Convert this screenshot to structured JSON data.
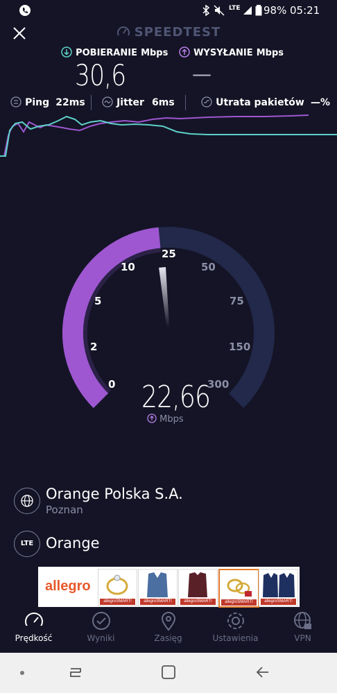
{
  "status_bar": {
    "battery": "98%",
    "time": "05:21",
    "network_label": "LTE"
  },
  "header": {
    "title": "SPEEDTEST",
    "close_icon": "close-icon"
  },
  "download": {
    "label": "POBIERANIE",
    "unit": "Mbps",
    "value": "30,6",
    "color": "#5ed1c8"
  },
  "upload": {
    "label": "WYSYŁANIE",
    "unit": "Mbps",
    "value": "—",
    "color": "#b77ee6"
  },
  "metrics": {
    "ping_label": "Ping",
    "ping_value": "22ms",
    "jitter_label": "Jitter",
    "jitter_value": "6ms",
    "loss_label": "Utrata pakietów",
    "loss_value": "—%"
  },
  "gauge": {
    "ticks": [
      "0",
      "2",
      "5",
      "10",
      "25",
      "50",
      "75",
      "150",
      "300"
    ],
    "current_value": "22,66",
    "unit": "Mbps",
    "fill_fraction": 0.48,
    "fill_color": "#9e57d1",
    "track_color": "#22294a"
  },
  "provider": {
    "name": "Orange Polska S.A.",
    "location": "Poznan",
    "network_name": "Orange",
    "network_badge": "LTE"
  },
  "ad": {
    "brand": "allegro",
    "tag": "allegroSMART!"
  },
  "bottom_nav": [
    {
      "label": "Prędkość",
      "icon": "speedometer-icon",
      "active": true
    },
    {
      "label": "Wyniki",
      "icon": "check-circle-icon",
      "active": false
    },
    {
      "label": "Zasięg",
      "icon": "map-pin-icon",
      "active": false
    },
    {
      "label": "Ustawienia",
      "icon": "gear-icon",
      "active": false
    },
    {
      "label": "VPN",
      "icon": "globe-lock-icon",
      "active": false
    }
  ],
  "system_nav": {
    "icons": [
      "home-dot-icon",
      "recent-apps-icon",
      "home-icon",
      "back-icon"
    ]
  }
}
